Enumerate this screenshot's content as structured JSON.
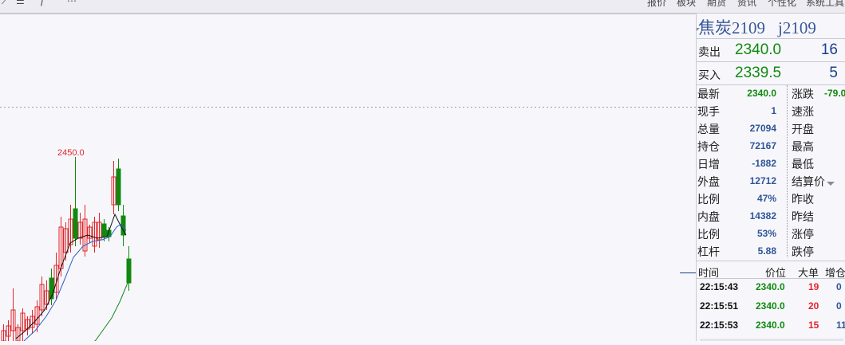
{
  "toolbar": {
    "right_menu": [
      "报价",
      "板块",
      "期货",
      "资讯",
      "个性化",
      "系统工具"
    ]
  },
  "chart": {
    "annotation_high": "2450.0"
  },
  "contract": {
    "title": "焦炭2109",
    "code": "j2109"
  },
  "quote": {
    "sell_label": "卖出",
    "sell_price": "2340.0",
    "sell_vol": "16",
    "buy_label": "买入",
    "buy_price": "2339.5",
    "buy_vol": "5"
  },
  "stats_left": [
    {
      "label": "最新",
      "value": "2340.0"
    },
    {
      "label": "现手",
      "value": "1"
    },
    {
      "label": "总量",
      "value": "27094"
    },
    {
      "label": "持仓",
      "value": "72167"
    },
    {
      "label": "日增",
      "value": "-1882"
    },
    {
      "label": "外盘",
      "value": "12712"
    },
    {
      "label": "比例",
      "value": "47%"
    },
    {
      "label": "内盘",
      "value": "14382"
    },
    {
      "label": "比例",
      "value": "53%"
    },
    {
      "label": "杠杆",
      "value": "5.88"
    }
  ],
  "stats_right": [
    {
      "label": "涨跌",
      "value": "-79.0"
    },
    {
      "label": "速涨",
      "value": ""
    },
    {
      "label": "开盘",
      "value": ""
    },
    {
      "label": "最高",
      "value": ""
    },
    {
      "label": "最低",
      "value": ""
    },
    {
      "label": "结算价",
      "value": ""
    },
    {
      "label": "昨收",
      "value": ""
    },
    {
      "label": "昨结",
      "value": ""
    },
    {
      "label": "涨停",
      "value": ""
    },
    {
      "label": "跌停",
      "value": ""
    }
  ],
  "ticks": {
    "headers": [
      "时间",
      "价位",
      "大单",
      "增仓"
    ],
    "rows": [
      {
        "time": "22:15:43",
        "price": "2340.0",
        "big": "19",
        "inc": "0"
      },
      {
        "time": "22:15:51",
        "price": "2340.0",
        "big": "20",
        "inc": "0"
      },
      {
        "time": "22:15:53",
        "price": "2340.0",
        "big": "15",
        "inc": "11"
      }
    ]
  },
  "colors": {
    "up": "#e0262b",
    "down": "#0f8a0f",
    "ma_short": "#111111",
    "ma_mid": "#2f5cc8",
    "ma_long": "#14861e",
    "label_blue": "#3b5998"
  }
}
